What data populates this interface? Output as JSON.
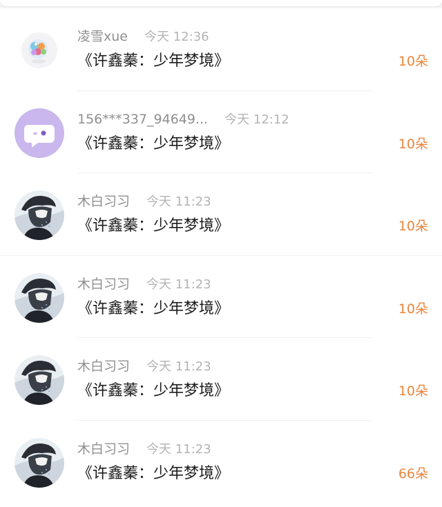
{
  "gift_records": [
    {
      "user": "凌雪xue",
      "time": "今天 12:36",
      "title": "《许鑫蓁：少年梦境》",
      "count": "10朵",
      "avatar_icon": "crystal-ball-icon"
    },
    {
      "user": "156***337_94649...",
      "time": "今天 12:12",
      "title": "《许鑫蓁：少年梦境》",
      "count": "10朵",
      "avatar_icon": "chat-bubble-icon"
    },
    {
      "user": "木白习习",
      "time": "今天 11:23",
      "title": "《许鑫蓁：少年梦境》",
      "count": "10朵",
      "avatar_icon": "portrait-photo"
    },
    {
      "user": "木白习习",
      "time": "今天 11:23",
      "title": "《许鑫蓁：少年梦境》",
      "count": "10朵",
      "avatar_icon": "portrait-photo"
    },
    {
      "user": "木白习习",
      "time": "今天 11:23",
      "title": "《许鑫蓁：少年梦境》",
      "count": "10朵",
      "avatar_icon": "portrait-photo"
    },
    {
      "user": "木白习习",
      "time": "今天 11:23",
      "title": "《许鑫蓁：少年梦境》",
      "count": "66朵",
      "avatar_icon": "portrait-photo"
    }
  ],
  "colors": {
    "flower_count": "#e8853c",
    "username": "#8f8f8f",
    "timestamp": "#b3b3b3",
    "title": "#1c1c1c",
    "chat_avatar_bg": "#c9b7ee"
  }
}
